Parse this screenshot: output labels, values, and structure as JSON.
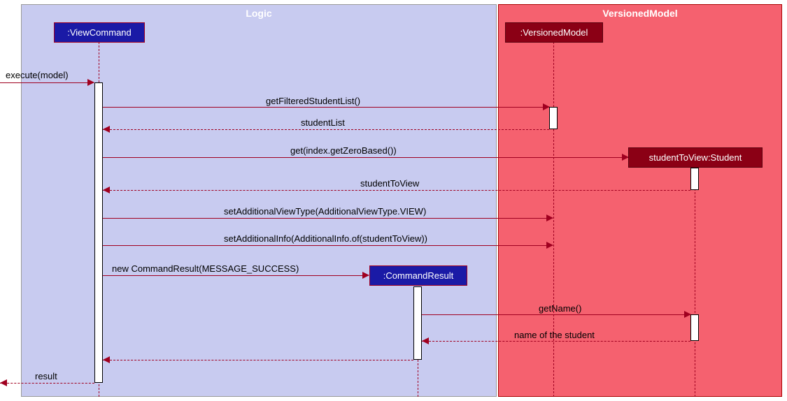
{
  "frames": {
    "logic": "Logic",
    "model": "VersionedModel"
  },
  "lifelines": {
    "viewCommand": ":ViewCommand",
    "versionedModel": ":VersionedModel",
    "student": "studentToView:Student",
    "commandResult": ":CommandResult"
  },
  "messages": {
    "execute": "execute(model)",
    "getFilteredList": "getFilteredStudentList()",
    "studentListReturn": "studentList",
    "getZeroBased": "get(index.getZeroBased())",
    "studentToViewReturn": "studentToView",
    "setViewType": "setAdditionalViewType(AdditionalViewType.VIEW)",
    "setAdditionalInfo": "setAdditionalInfo(AdditionalInfo.of(studentToView))",
    "newCommandResult": "new CommandResult(MESSAGE_SUCCESS)",
    "getName": "getName()",
    "nameReturn": "name of the student",
    "result": "result"
  }
}
